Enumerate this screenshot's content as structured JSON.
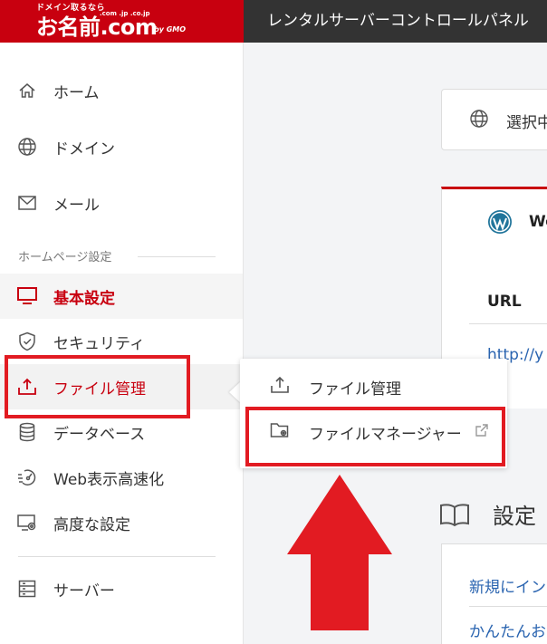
{
  "header": {
    "logo_tagline": "ドメイン取るなら",
    "logo_text": "お名前.com",
    "logo_domains": ".com .jp .co.jp",
    "logo_by": "by GMO",
    "title": "レンタルサーバーコントロールパネル"
  },
  "sidebar": {
    "items_top": [
      {
        "label": "ホーム",
        "icon": "home-icon"
      },
      {
        "label": "ドメイン",
        "icon": "globe-icon"
      },
      {
        "label": "メール",
        "icon": "mail-icon"
      }
    ],
    "section_label": "ホームページ設定",
    "items_hp": [
      {
        "label": "基本設定",
        "icon": "monitor-icon",
        "state": "active"
      },
      {
        "label": "セキュリティ",
        "icon": "shield-icon"
      },
      {
        "label": "ファイル管理",
        "icon": "upload-icon",
        "state": "hover"
      },
      {
        "label": "データベース",
        "icon": "database-icon"
      },
      {
        "label": "Web表示高速化",
        "icon": "speed-icon"
      },
      {
        "label": "高度な設定",
        "icon": "advanced-settings-icon"
      }
    ],
    "items_bottom": [
      {
        "label": "サーバー",
        "icon": "server-icon"
      }
    ]
  },
  "popup": {
    "items": [
      {
        "label": "ファイル管理",
        "icon": "upload-icon"
      },
      {
        "label": "ファイルマネージャー",
        "icon": "folder-gear-icon",
        "external": true
      }
    ]
  },
  "main": {
    "select_card_label": "選択中",
    "wp_card_label": "Wo",
    "url_label": "URL",
    "url_value": "http://y",
    "settings_title": "設定",
    "settings_link1": "新規にイン",
    "settings_link2": "かんたんお"
  },
  "colors": {
    "brand_red": "#c8000f",
    "annotation_red": "#e21b22",
    "link_blue": "#2a64b0",
    "topbar": "#333333"
  }
}
